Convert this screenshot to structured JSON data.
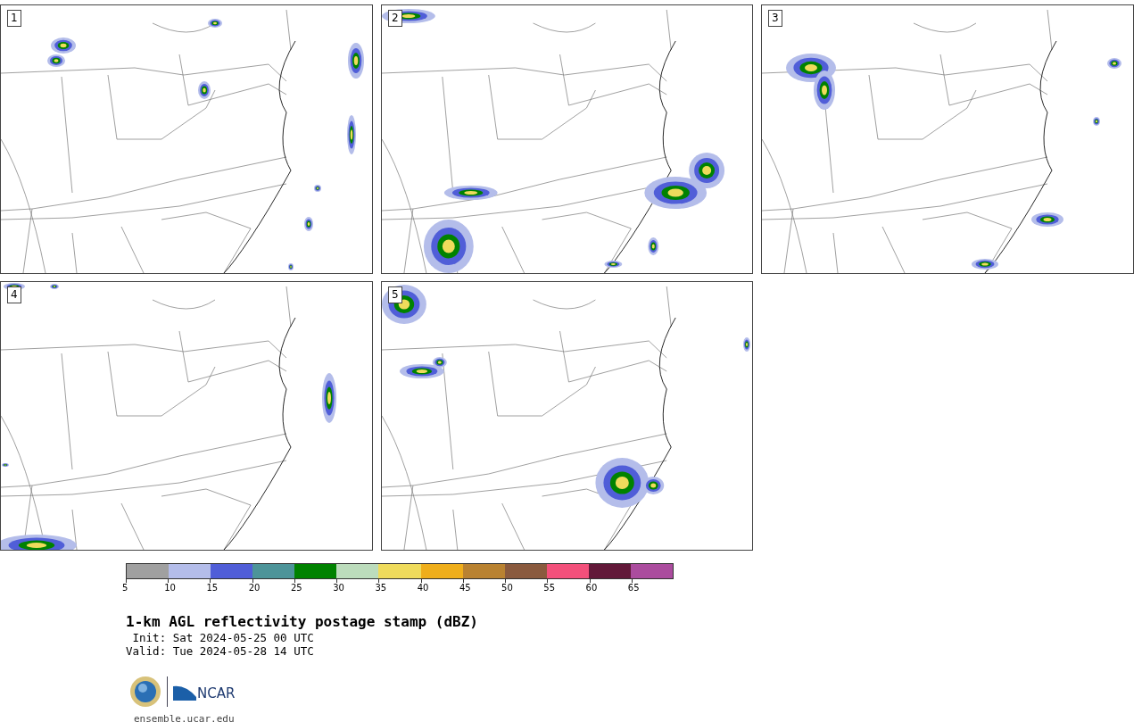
{
  "panels": [
    {
      "label": "1"
    },
    {
      "label": "2"
    },
    {
      "label": "3"
    },
    {
      "label": "4"
    },
    {
      "label": "5"
    }
  ],
  "colorbar": {
    "segments": [
      {
        "color": "#a0a0a0"
      },
      {
        "color": "#b4bdea"
      },
      {
        "color": "#505ed8"
      },
      {
        "color": "#4d9499"
      },
      {
        "color": "#008200"
      },
      {
        "color": "#bcdcbc"
      },
      {
        "color": "#efdb5c"
      },
      {
        "color": "#efae1b"
      },
      {
        "color": "#b98231"
      },
      {
        "color": "#8a5a3e"
      },
      {
        "color": "#f3507b"
      },
      {
        "color": "#621939"
      },
      {
        "color": "#ab4c9e"
      }
    ],
    "ticks": [
      "5",
      "10",
      "15",
      "20",
      "25",
      "30",
      "35",
      "40",
      "45",
      "50",
      "55",
      "60",
      "65"
    ]
  },
  "title": "1-km AGL reflectivity postage stamp (dBZ)",
  "init": " Init: Sat 2024-05-25 00 UTC",
  "valid": "Valid: Tue 2024-05-28 14 UTC",
  "logo": {
    "text": "NCAR"
  },
  "footer": "ensemble.ucar.edu"
}
